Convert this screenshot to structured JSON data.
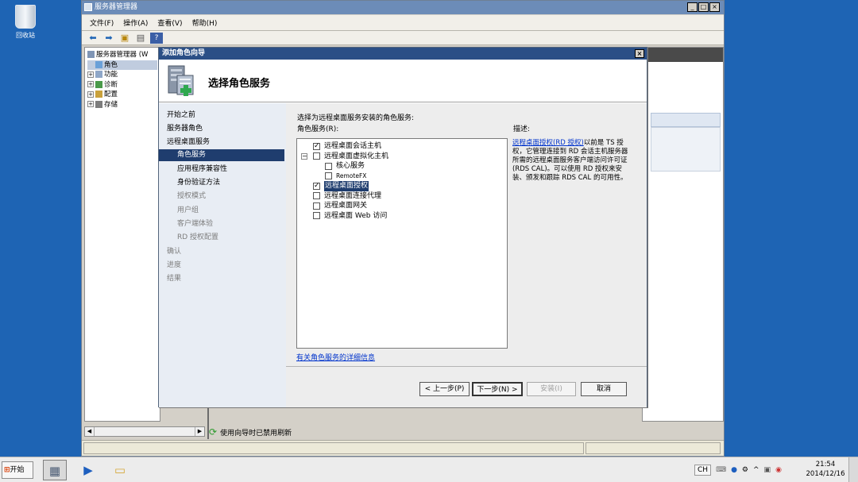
{
  "desktop": {
    "recycle_bin": "回收站"
  },
  "server_manager": {
    "title": "服务器管理器",
    "window_buttons": [
      "_",
      "□",
      "×"
    ],
    "menu": [
      "文件(F)",
      "操作(A)",
      "查看(V)",
      "帮助(H)"
    ],
    "tree": [
      {
        "label": "服务器管理器 (W",
        "toggle": "",
        "indent": 0
      },
      {
        "label": "角色",
        "toggle": "",
        "indent": 1,
        "selected": true
      },
      {
        "label": "功能",
        "toggle": "⊞",
        "indent": 1
      },
      {
        "label": "诊断",
        "toggle": "⊞",
        "indent": 1
      },
      {
        "label": "配置",
        "toggle": "⊞",
        "indent": 1
      },
      {
        "label": "存储",
        "toggle": "⊞",
        "indent": 1
      }
    ],
    "scroll_left": "◀",
    "scroll_right": "▶",
    "status": "使用向导时已禁用刷新"
  },
  "wizard": {
    "title": "添加角色向导",
    "close": "×",
    "heading": "选择角色服务",
    "nav": [
      {
        "label": "开始之前",
        "level": 0,
        "state": "normal"
      },
      {
        "label": "服务器角色",
        "level": 0,
        "state": "normal"
      },
      {
        "label": "远程桌面服务",
        "level": 0,
        "state": "normal"
      },
      {
        "label": "角色服务",
        "level": 1,
        "state": "active"
      },
      {
        "label": "应用程序兼容性",
        "level": 1,
        "state": "normal"
      },
      {
        "label": "身份验证方法",
        "level": 1,
        "state": "normal"
      },
      {
        "label": "授权模式",
        "level": 1,
        "state": "dim"
      },
      {
        "label": "用户组",
        "level": 1,
        "state": "dim"
      },
      {
        "label": "客户端体验",
        "level": 1,
        "state": "dim"
      },
      {
        "label": "RD 授权配置",
        "level": 1,
        "state": "dim"
      },
      {
        "label": "确认",
        "level": 0,
        "state": "dim"
      },
      {
        "label": "进度",
        "level": 0,
        "state": "dim"
      },
      {
        "label": "结果",
        "level": 0,
        "state": "dim"
      }
    ],
    "instruction": "选择为远程桌面服务安装的角色服务:",
    "list_label": "角色服务(R):",
    "role_services": [
      {
        "label": "远程桌面会话主机",
        "checked": true,
        "indent": 0,
        "toggle": ""
      },
      {
        "label": "远程桌面虚拟化主机",
        "checked": false,
        "indent": 0,
        "toggle": "−"
      },
      {
        "label": "核心服务",
        "checked": false,
        "indent": 1,
        "toggle": ""
      },
      {
        "label": "RemoteFX",
        "checked": false,
        "indent": 1,
        "toggle": ""
      },
      {
        "label": "远程桌面授权",
        "checked": true,
        "indent": 0,
        "toggle": "",
        "selected": true
      },
      {
        "label": "远程桌面连接代理",
        "checked": false,
        "indent": 0,
        "toggle": ""
      },
      {
        "label": "远程桌面网关",
        "checked": false,
        "indent": 0,
        "toggle": ""
      },
      {
        "label": "远程桌面 Web 访问",
        "checked": false,
        "indent": 0,
        "toggle": ""
      }
    ],
    "description_label": "描述:",
    "description_link": "远程桌面授权(RD 授权)",
    "description_text": "以前是 TS 授权，它管理连接到 RD 会话主机服务器所需的远程桌面服务客户端访问许可证(RDS CAL)。可以使用 RD 授权来安装、颁发和跟踪 RDS CAL 的可用性。",
    "more_info_link": "有关角色服务的详细信息",
    "buttons": {
      "back": "< 上一步(P)",
      "next": "下一步(N) >",
      "install": "安装(I)",
      "cancel": "取消"
    }
  },
  "taskbar": {
    "start": "开始",
    "language": "CH",
    "time": "21:54",
    "date": "2014/12/16"
  },
  "colors": {
    "desktop": "#1e64b4",
    "dialog_title": "#2b4f86",
    "nav_active": "#1f3d6e",
    "link": "#0033cc"
  }
}
